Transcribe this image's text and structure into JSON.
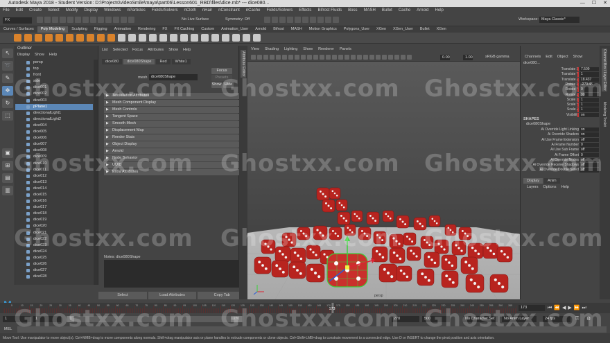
{
  "window": {
    "title": "Autodesk Maya 2018 - Student Version: D:\\Projects\\videoSmile\\maya\\part06\\Lesson601_RBD\\files\\dice.mb* --- dice080..."
  },
  "menubar": [
    "File",
    "Edit",
    "Create",
    "Select",
    "Modify",
    "Display",
    "Windows",
    "nParticles",
    "Fields/Solvers",
    "nCloth",
    "nHair",
    "nConstraint",
    "nCache",
    "Fields/Solvers",
    "Effects",
    "Bifrost Fluids",
    "Boss",
    "MASH",
    "Bullet",
    "Cache",
    "Arnold",
    "Help"
  ],
  "statusline": {
    "mode": "FX",
    "live_surface": "No Live Surface",
    "symmetry": "Symmetry: Off",
    "workspace_label": "Workspace:",
    "workspace_value": "Maya Classic*"
  },
  "shelf_tabs": [
    "Curves / Surfaces",
    "Poly Modeling",
    "Sculpting",
    "Rigging",
    "Animation",
    "Rendering",
    "FX",
    "FX Caching",
    "Custom",
    "Animation_User",
    "Arnold",
    "Bifrost",
    "MASH",
    "Motion Graphics",
    "Polygons_User",
    "XGen",
    "XGen_User",
    "Bullet",
    "XGen"
  ],
  "outliner": {
    "title": "Outliner",
    "menu": [
      "Display",
      "Show",
      "Help"
    ],
    "items": [
      "persp",
      "top",
      "front",
      "side",
      "dice001",
      "dice002",
      "dice003",
      "pPlane1",
      "directionalLight1",
      "directionalLight2",
      "dice004",
      "dice005",
      "dice006",
      "dice007",
      "dice008",
      "dice009",
      "dice010",
      "dice011",
      "dice012",
      "dice013",
      "dice014",
      "dice015",
      "dice016",
      "dice017",
      "dice018",
      "dice019",
      "dice020",
      "dice021",
      "dice022",
      "dice023",
      "dice024",
      "dice025",
      "dice026",
      "dice027",
      "dice028"
    ],
    "selected_index": 7
  },
  "attribute_editor": {
    "menu": [
      "List",
      "Selected",
      "Focus",
      "Attributes",
      "Show",
      "Help"
    ],
    "tabs": [
      "dice080",
      "dice080Shape",
      "Red",
      "White1"
    ],
    "active_tab": 1,
    "mesh_label": "mesh",
    "mesh_value": "dice080Shape",
    "buttons": {
      "focus": "Focus",
      "presets": "Presets",
      "show": "Show",
      "hide": "Hide"
    },
    "sections": [
      "Tessellation Attributes",
      "Mesh Component Display",
      "Mesh Controls",
      "Tangent Space",
      "Smooth Mesh",
      "Displacement Map",
      "Render Stats",
      "Object Display",
      "Arnold",
      "Node Behavior",
      "UUID",
      "Extra Attributes"
    ],
    "notes_label": "Notes:  dice080Shape",
    "bottom_buttons": [
      "Select",
      "Load Attributes",
      "Copy Tab"
    ],
    "side_tab": "Attribute Editor"
  },
  "viewport": {
    "menu": [
      "View",
      "Shading",
      "Lighting",
      "Show",
      "Renderer",
      "Panels"
    ],
    "gamma_label": "sRGB gamma",
    "gamma_value": "1.00",
    "exposure_value": "0.00",
    "camera_label": "persp",
    "accent": "#c9302c"
  },
  "channel_box": {
    "menu": [
      "Channels",
      "Edit",
      "Object",
      "Show"
    ],
    "object": "dice080...",
    "channels": [
      {
        "name": "Translate X",
        "value": "7.509"
      },
      {
        "name": "Translate Y",
        "value": "1"
      },
      {
        "name": "Translate Z",
        "value": "18.437"
      },
      {
        "name": "Rotate X",
        "value": "-270.45"
      },
      {
        "name": "Rotate Y",
        "value": "0"
      },
      {
        "name": "Rotate Z",
        "value": "90"
      },
      {
        "name": "Scale X",
        "value": "1"
      },
      {
        "name": "Scale Y",
        "value": "1"
      },
      {
        "name": "Scale Z",
        "value": "1"
      },
      {
        "name": "Visibility",
        "value": "on"
      }
    ],
    "shapes_header": "SHAPES",
    "shape_name": "dice080Shape",
    "shape_attrs": [
      {
        "name": "Ai Override Light Linking",
        "value": "on"
      },
      {
        "name": "Ai Override Shaders",
        "value": "on"
      },
      {
        "name": "Ai Use Frame Extension",
        "value": "off"
      },
      {
        "name": "Ai Frame Number",
        "value": "0"
      },
      {
        "name": "Ai Use Sub Frame",
        "value": "off"
      },
      {
        "name": "Ai Frame Offset",
        "value": "0"
      },
      {
        "name": "Ai Override Nodes",
        "value": "off"
      },
      {
        "name": "Ai Override Receive Shadows",
        "value": "off"
      },
      {
        "name": "Ai Override Double Sided",
        "value": "off"
      }
    ],
    "layer_tabs": [
      "Display",
      "Anim"
    ],
    "layer_menu": [
      "Layers",
      "Options",
      "Help"
    ],
    "vertical_tabs": [
      "Channel Box / Layer Editor",
      "Modeling Toolkit"
    ]
  },
  "timeline": {
    "current_frame": "173",
    "current_frame_field": "173",
    "tick_labels": [
      "5",
      "10",
      "15",
      "20",
      "25",
      "30",
      "35",
      "40",
      "45",
      "50",
      "55",
      "60",
      "65",
      "70",
      "75",
      "80",
      "85",
      "90",
      "95",
      "100",
      "105",
      "110",
      "115",
      "120",
      "125",
      "130",
      "135",
      "140",
      "145",
      "150",
      "155",
      "160",
      "165",
      "170",
      "175",
      "180",
      "185",
      "190",
      "195",
      "200",
      "205",
      "210",
      "215",
      "220",
      "225",
      "230",
      "235",
      "240",
      "245",
      "250",
      "255",
      "260",
      "265",
      "270"
    ],
    "tick_values": [
      5,
      10,
      15,
      20,
      25,
      30,
      35,
      40,
      45,
      50,
      55,
      60,
      65,
      70,
      75,
      80,
      85,
      90,
      95,
      100,
      105,
      110,
      115,
      120,
      125,
      130,
      135,
      140,
      145,
      150,
      155,
      160,
      165,
      170,
      175,
      180,
      185,
      190,
      195,
      200,
      205,
      210,
      215,
      220,
      225,
      230,
      235,
      240,
      245,
      250,
      255,
      260,
      265,
      270
    ],
    "timeline_end": 270
  },
  "range": {
    "start": "1",
    "start_inner": "1",
    "handle_label": "1",
    "end_inner": "270",
    "end": "270",
    "total": "500",
    "character_set": "No Character Set",
    "anim_layer": "No Anim Layer",
    "fps": "24 fps"
  },
  "command": {
    "label": "MEL"
  },
  "help_line": "Move Tool: Use manipulator to move object(s). Ctrl+MMB+drag to move components along normals. Shift+drag manipulator axis or plane handles to extrude components or clone objects. Ctrl+Shift+LMB+drag to constrain movement to a connected edge. Use D or INSERT to change the pivot position and axis orientation.",
  "watermark": "Ghostxx.com"
}
